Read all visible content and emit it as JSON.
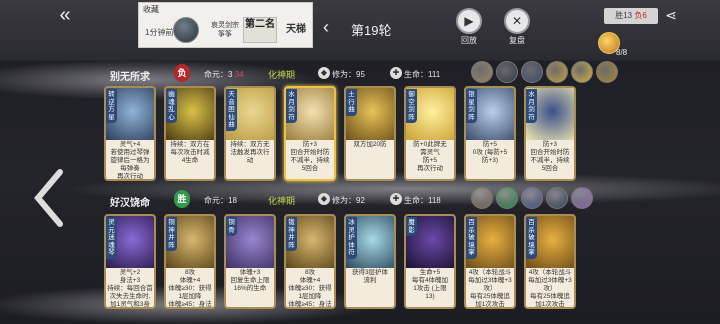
{
  "header": {
    "back_icon": "double-chevron-left-icon",
    "record": {
      "title": "收藏",
      "time_ago": "1分钟前",
      "player_name": "哀灵剑宗",
      "player_sub": "筝筝",
      "rank_label": "第二名",
      "tier_label": "天梯"
    },
    "round_label": "第19轮",
    "replay_label": "回放",
    "review_label": "复盘",
    "score_win": "胜13",
    "score_lose": "负6",
    "coin_count": "8/8"
  },
  "players": [
    {
      "name": "别无所求",
      "result": "负",
      "life_prefix": "命元：",
      "life_value": "3",
      "life_red": "34",
      "realm": "化神期",
      "cultivation_label": "修为：",
      "cultivation": "95",
      "hp_label": "生命：",
      "hp": "111",
      "buff_colors": [
        "#9a8766",
        "#343a4a",
        "#3b4b6a",
        "#c9a23a",
        "#d7b33b",
        "#a98a2a"
      ]
    },
    {
      "name": "好汉饶命",
      "result": "胜",
      "life_prefix": "命元：",
      "life_value": "18",
      "life_red": "",
      "realm": "化神期",
      "cultivation_label": "修为：",
      "cultivation": "92",
      "hp_label": "生命：",
      "hp": "118",
      "buff_colors": [
        "#7a6a55",
        "#2e8a4a",
        "#4a5a8a",
        "#3d4a60",
        "#8a6bb0"
      ]
    }
  ],
  "cards_top": [
    {
      "name": "转逆方星",
      "lines": [
        "灵气+4",
        "若使用过琴弹",
        "旋律后一格为",
        "每弹奏",
        "再次行动"
      ],
      "art": [
        "#8fb5d8",
        "#2d3c5a"
      ]
    },
    {
      "name": "幽魂乱心",
      "lines": [
        "持续：双方在",
        "每次攻击时减",
        "4生命"
      ],
      "art": [
        "#d9c24a",
        "#4a3a10"
      ]
    },
    {
      "name": "天音困仙曲",
      "lines": [
        "持续：双方无",
        "法触发再次行",
        "动"
      ],
      "art": [
        "#e9d891",
        "#b99a40"
      ]
    },
    {
      "name": "水月剑符",
      "lines": [
        "防+3",
        "回合开始时防",
        "不减半，持续",
        "5回合"
      ],
      "art": [
        "#f2e2b0",
        "#9a7a3a"
      ]
    },
    {
      "name": "土行曲",
      "lines": [
        "双方加20防"
      ],
      "art": [
        "#e8c35a",
        "#6a5018"
      ]
    },
    {
      "name": "御空剑阵",
      "lines": [
        "防+0此牌无",
        "需灵气",
        "防+5",
        "再次行动"
      ],
      "art": [
        "#fff0a0",
        "#caa030"
      ]
    },
    {
      "name": "银星剑阵",
      "lines": [
        "防+5",
        "0攻 (每防+5",
        "防+3)"
      ],
      "art": [
        "#bad0ea",
        "#3a4a6a"
      ]
    },
    {
      "name": "水月剑符",
      "lines": [
        "防+3",
        "回合开始时防",
        "不减半，持续",
        "5回合"
      ],
      "art": [
        "#3a4f8a",
        "#f0e8b0"
      ]
    }
  ],
  "cards_bottom": [
    {
      "name": "灵元迷魂琴",
      "lines": [
        "灵气+2",
        "身法+3",
        "持续：每回合首",
        "次失去生命时,",
        "加1灵气和3身法"
      ],
      "art": [
        "#8a6ad8",
        "#2a1a4a"
      ]
    },
    {
      "name": "铜神井阵",
      "lines": [
        "8攻",
        "体魄+4",
        "体魄≥30：获得",
        "1层加降",
        "体魄≥45：身法+3"
      ],
      "art": [
        "#d8b870",
        "#5a4418"
      ]
    },
    {
      "name": "铜骨",
      "lines": [
        "体魄+3",
        "回复生命上限",
        "16%的生命"
      ],
      "art": [
        "#9a86d0",
        "#3a3060"
      ]
    },
    {
      "name": "锻神井阵",
      "lines": [
        "8攻",
        "体魄+4",
        "体魄≥30：获得",
        "1层加降",
        "体魄≥45：身法+3"
      ],
      "art": [
        "#d8b870",
        "#5a4418"
      ]
    },
    {
      "name": "冰灵护体符",
      "lines": [
        "获得3层护体",
        "流利"
      ],
      "art": [
        "#a8d8e8",
        "#2a4a5a"
      ]
    },
    {
      "name": "魔影",
      "lines": [
        "生命+5",
        "每有4体魄加",
        "1攻击 (上限",
        "13)"
      ],
      "art": [
        "#6a4aa8",
        "#1a1030"
      ]
    },
    {
      "name": "百杀破境掌",
      "lines": [
        "4攻（本轮战斗",
        "每加过3体魄+3",
        "攻）",
        "每有25体魄追",
        "加1次攻击"
      ],
      "art": [
        "#e8b040",
        "#6a4a18"
      ]
    },
    {
      "name": "百杀破境掌",
      "lines": [
        "4攻（本轮战斗",
        "每加过3体魄+3",
        "攻）",
        "每有25体魄追",
        "加1次攻击"
      ],
      "art": [
        "#e8b040",
        "#6a4a18"
      ]
    }
  ]
}
